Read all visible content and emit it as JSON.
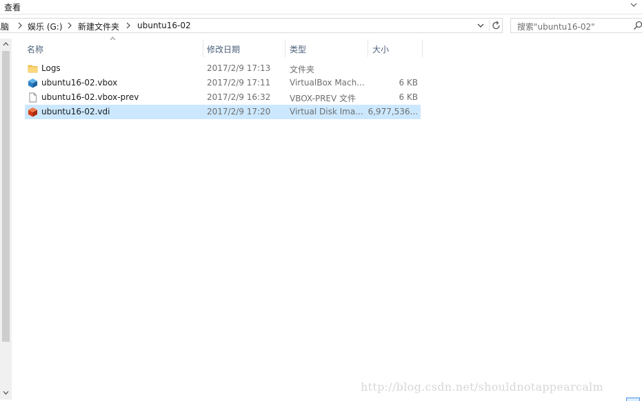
{
  "menubar": {
    "view_label": "查看"
  },
  "address": {
    "crumbs": [
      "电脑",
      "娱乐 (G:)",
      "新建文件夹",
      "ubuntu16-02"
    ]
  },
  "search": {
    "placeholder": "搜索\"ubuntu16-02\""
  },
  "columns": {
    "name": "名称",
    "date": "修改日期",
    "type": "类型",
    "size": "大小"
  },
  "files": [
    {
      "name": "Logs",
      "date": "2017/2/9 17:13",
      "type": "文件夹",
      "size": "",
      "icon": "folder-icon"
    },
    {
      "name": "ubuntu16-02.vbox",
      "date": "2017/2/9 17:11",
      "type": "VirtualBox Mach...",
      "size": "6 KB",
      "icon": "virtualbox-icon"
    },
    {
      "name": "ubuntu16-02.vbox-prev",
      "date": "2017/2/9 16:32",
      "type": "VBOX-PREV 文件",
      "size": "6 KB",
      "icon": "file-icon"
    },
    {
      "name": "ubuntu16-02.vdi",
      "date": "2017/2/9 17:20",
      "type": "Virtual Disk Ima...",
      "size": "6,977,536...",
      "icon": "virtual-disk-icon",
      "selected": true
    }
  ],
  "watermark": "http://blog.csdn.net/shouldnotappearcalm",
  "colors": {
    "selection": "#cce8ff",
    "header_text": "#4c607a",
    "folder": "#f6c85f"
  }
}
